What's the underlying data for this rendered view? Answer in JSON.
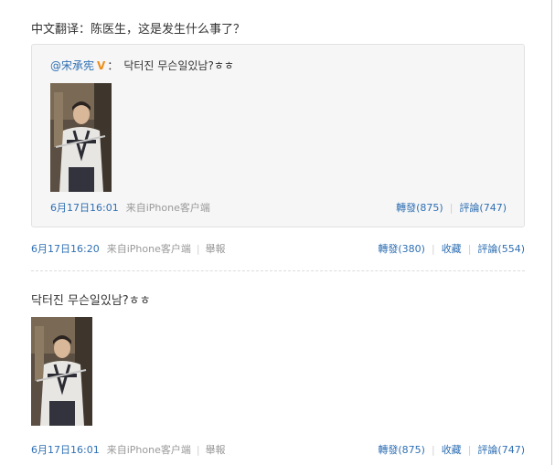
{
  "posts": [
    {
      "text": "中文翻译：陈医生，这是发生什么事了？",
      "repost": {
        "author": "@宋承宪",
        "badge": "V",
        "colon": "：",
        "text": "닥터진 무슨일있남?ㅎㅎ",
        "photo_icon": "photo-thumbnail",
        "time": "6月17日16:01",
        "source": "来自iPhone客户端",
        "actions": [
          "轉發(875)",
          "評論(747)"
        ]
      },
      "time": "6月17日16:20",
      "source": "来自iPhone客户端",
      "report": "舉報",
      "actions": [
        "轉發(380)",
        "收藏",
        "評論(554)"
      ]
    },
    {
      "text": "닥터진 무슨일있남?ㅎㅎ",
      "photo_icon": "photo-thumbnail",
      "time": "6月17日16:01",
      "source": "来自iPhone客户端",
      "report": "舉報",
      "actions": [
        "轉發(875)",
        "收藏",
        "評論(747)"
      ]
    }
  ],
  "colors": {
    "link": "#2e6fb3",
    "muted": "#999999",
    "badge": "#ec8f1b",
    "repost_bg": "#f6f6f6"
  }
}
